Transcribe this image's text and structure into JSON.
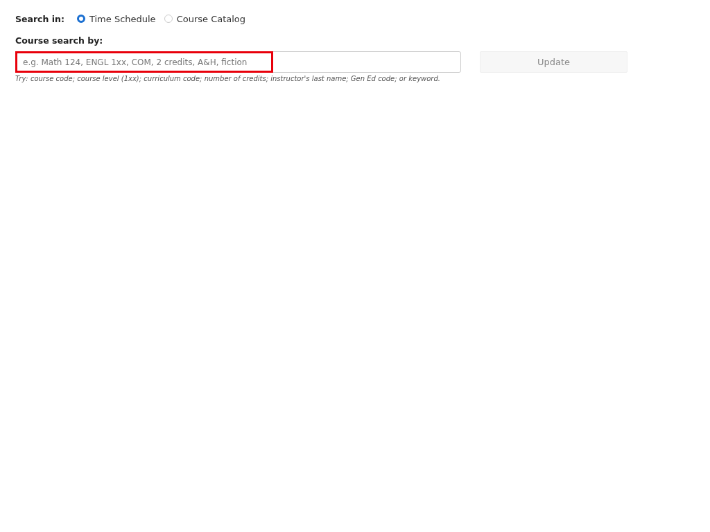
{
  "search_in": {
    "label": "Search in:",
    "options": [
      {
        "label": "Time Schedule",
        "selected": true
      },
      {
        "label": "Course Catalog",
        "selected": false
      }
    ]
  },
  "course_search": {
    "label": "Course search by:",
    "placeholder": "e.g. Math 124, ENGL 1xx, COM, 2 credits, A&H, fiction",
    "highlighted": true,
    "hint": "Try: course code; course level (1xx); curriculum code; number of credits; instructor's last name; Gen Ed code; or keyword."
  },
  "update_button": {
    "label": "Update",
    "disabled": true
  }
}
